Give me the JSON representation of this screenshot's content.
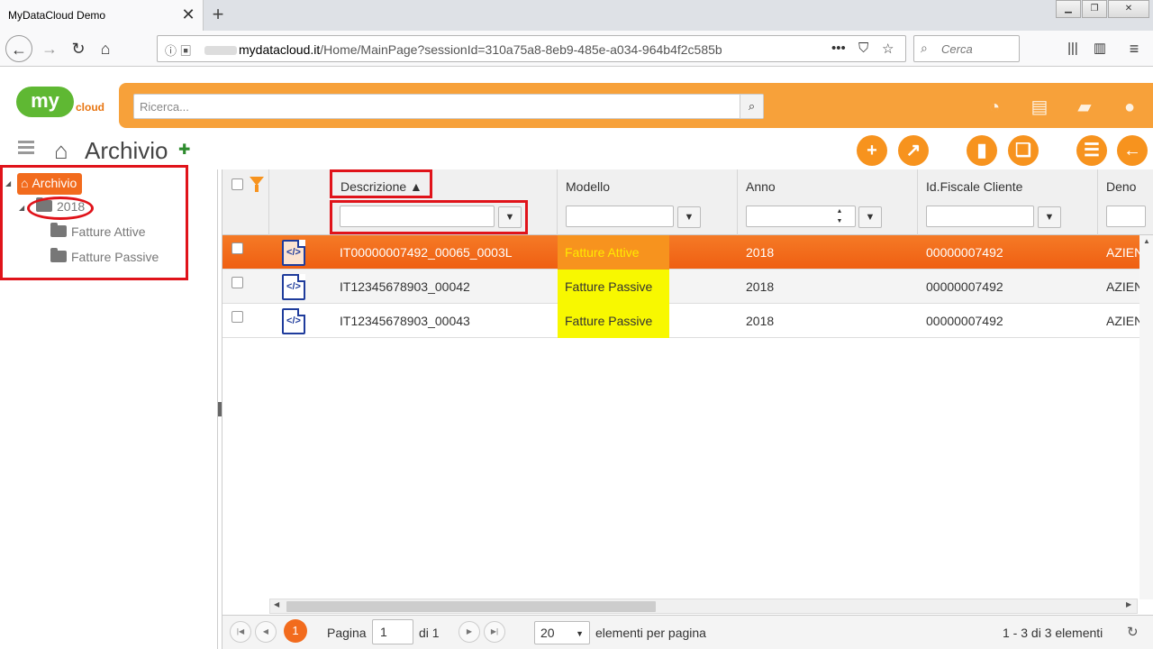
{
  "browser": {
    "tab_title": "MyDataCloud Demo",
    "tab_close": "✕",
    "new_tab": "+",
    "url_domain": "mydatacloud.it",
    "url_path": "/Home/MainPage?sessionId=310a75a8-8eb9-485e-a034-964b4f2c585b",
    "search_placeholder": "Cerca"
  },
  "app": {
    "logo_my": "my",
    "logo_cloud": "cloud",
    "search_placeholder": "Ricerca...",
    "page_title": "Archivio"
  },
  "tree": {
    "root": "Archivio",
    "year": "2018",
    "children": [
      "Fatture Attive",
      "Fatture Passive"
    ]
  },
  "grid": {
    "columns": {
      "descrizione": "Descrizione ▲",
      "modello": "Modello",
      "anno": "Anno",
      "idfiscale": "Id.Fiscale Cliente",
      "deno": "Deno"
    },
    "rows": [
      {
        "descrizione": "IT00000007492_00065_0003L",
        "modello": "Fatture Attive",
        "anno": "2018",
        "idfiscale": "00000007492",
        "deno": "AZIEN",
        "selected": true
      },
      {
        "descrizione": "IT12345678903_00042",
        "modello": "Fatture Passive",
        "anno": "2018",
        "idfiscale": "00000007492",
        "deno": "AZIEN",
        "selected": false
      },
      {
        "descrizione": "IT12345678903_00043",
        "modello": "Fatture Passive",
        "anno": "2018",
        "idfiscale": "00000007492",
        "deno": "AZIEN",
        "selected": false
      }
    ]
  },
  "pager": {
    "current": "1",
    "pagina_label": "Pagina",
    "page_value": "1",
    "of_label": "di 1",
    "page_size": "20",
    "per_page_label": "elementi per pagina",
    "summary": "1 - 3 di 3 elementi"
  },
  "colors": {
    "accent": "#f7931e",
    "selected_row": "#f26b1d",
    "highlight": "#f8f800",
    "annotation": "#e0131a"
  }
}
